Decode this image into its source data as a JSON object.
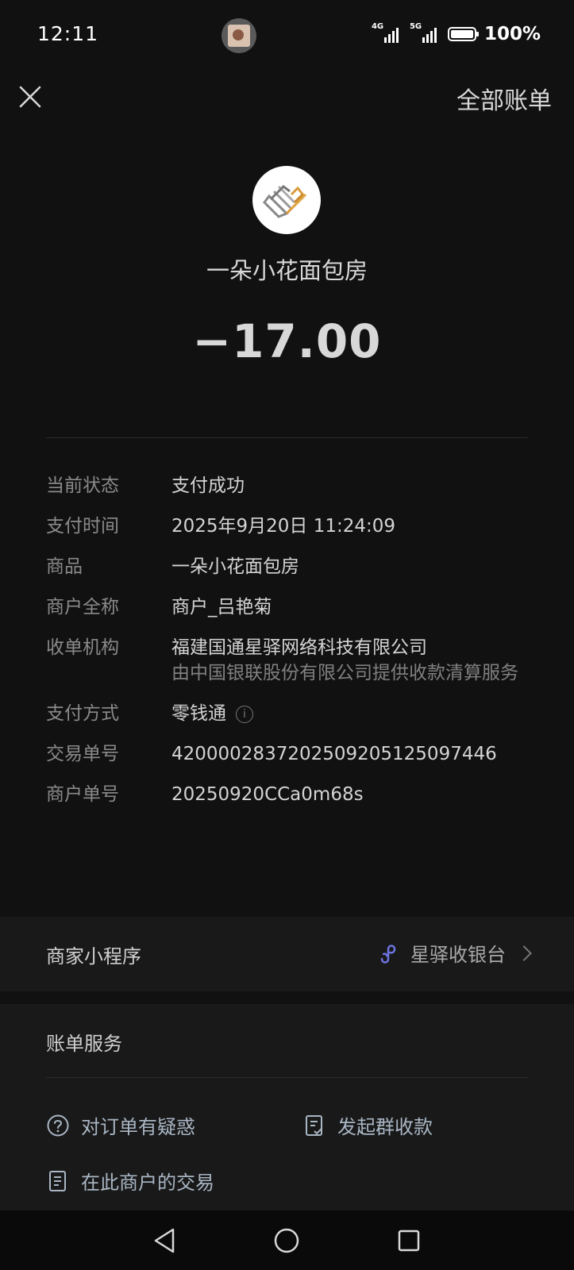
{
  "status_bar": {
    "time": "12:11",
    "network1": "4G",
    "network2": "5G",
    "battery": "100%"
  },
  "header": {
    "close_icon": "close-icon",
    "all_bills": "全部账单"
  },
  "merchant": {
    "name": "一朵小花面包房",
    "amount": "−17.00",
    "logo_icon": "merchant-logo"
  },
  "details": {
    "status_label": "当前状态",
    "status_value": "支付成功",
    "time_label": "支付时间",
    "time_value": "2025年9月20日 11:24:09",
    "goods_label": "商品",
    "goods_value": "一朵小花面包房",
    "merchant_full_label": "商户全称",
    "merchant_full_value": "商户_吕艳菊",
    "acquirer_label": "收单机构",
    "acquirer_value": "福建国通星驿网络科技有限公司",
    "acquirer_sub": "由中国银联股份有限公司提供收款清算服务",
    "pay_method_label": "支付方式",
    "pay_method_value": "零钱通",
    "trade_no_label": "交易单号",
    "trade_no_value": "4200002837202509205125097446",
    "merchant_no_label": "商户单号",
    "merchant_no_value": "20250920CCa0m68s"
  },
  "mini_program": {
    "label": "商家小程序",
    "name": "星驿收银台",
    "icon": "mini-program-icon"
  },
  "bill_service": {
    "title": "账单服务",
    "items": [
      {
        "label": "对订单有疑惑",
        "icon": "question-icon"
      },
      {
        "label": "发起群收款",
        "icon": "group-collect-icon"
      },
      {
        "label": "在此商户的交易",
        "icon": "document-icon"
      }
    ]
  },
  "colors": {
    "background": "#111111",
    "section": "#191919",
    "link": "#a9b6c4",
    "mini_icon": "#6b74e0"
  }
}
